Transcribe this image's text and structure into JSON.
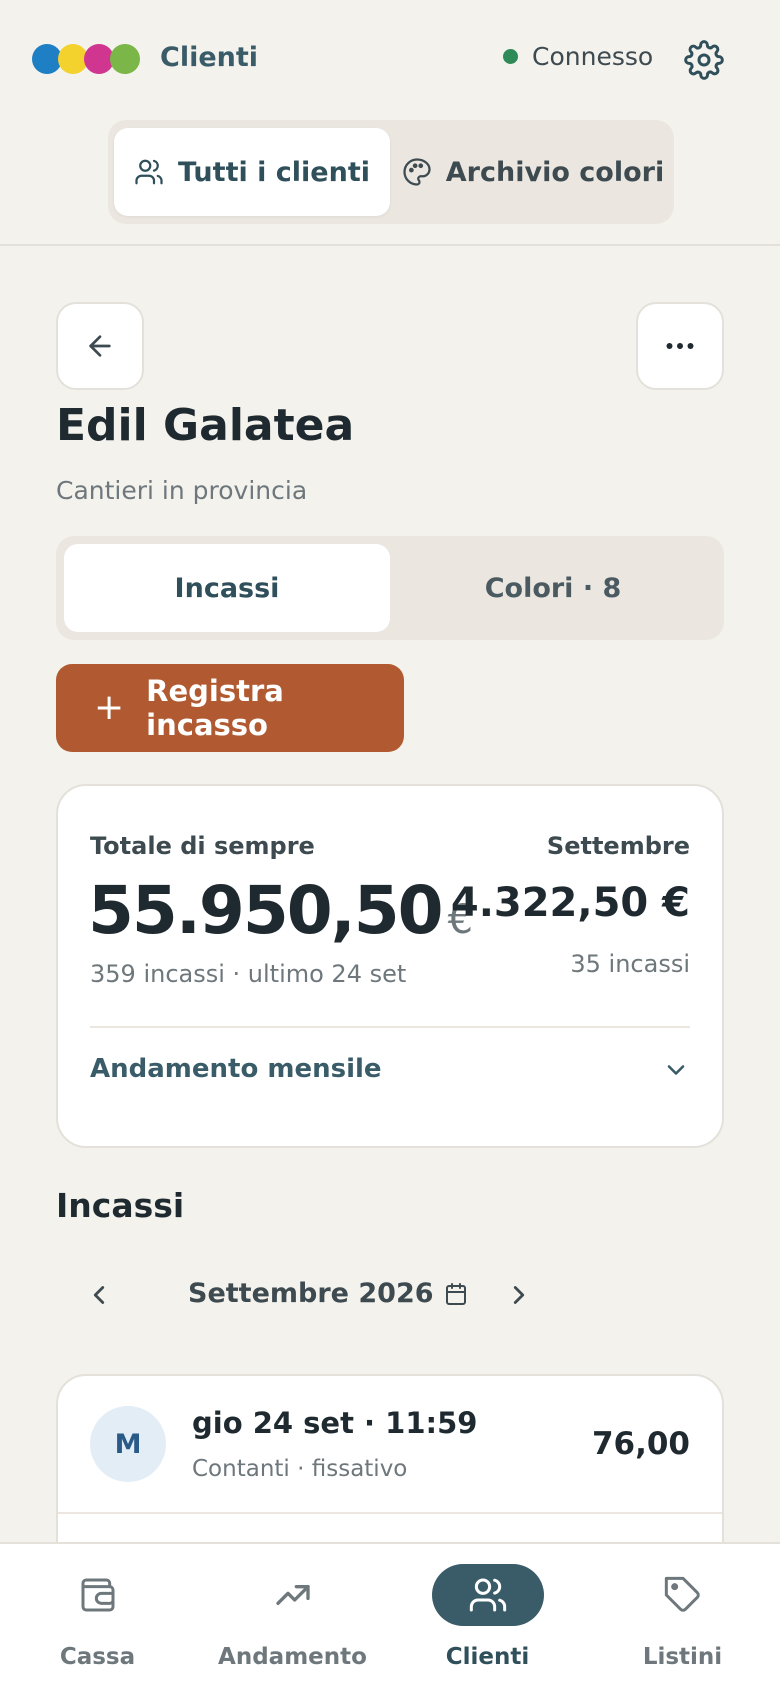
{
  "header": {
    "app_title": "Clienti",
    "logo_colors": [
      "#1e7fc4",
      "#f4d22e",
      "#d0368f",
      "#7ab648"
    ],
    "status": {
      "label": "Connesso",
      "color": "#2e8a57"
    },
    "settings_icon": "gear-icon"
  },
  "top_tabs": [
    {
      "label": "Tutti i clienti",
      "icon": "users-icon",
      "active": true
    },
    {
      "label": "Archivio colori",
      "icon": "palette-icon",
      "active": false
    }
  ],
  "client": {
    "name": "Edil Galatea",
    "subtitle": "Cantieri in provincia"
  },
  "detail_tabs": [
    {
      "label": "Incassi",
      "active": true
    },
    {
      "label": "Colori · 8",
      "active": false
    }
  ],
  "primary_action": {
    "label": "Registra incasso",
    "icon": "plus-icon",
    "color": "#b15a32"
  },
  "summary": {
    "total_label": "Totale di sempre",
    "total_value": "55.950,50",
    "currency": "€",
    "total_sub": "359 incassi · ultimo 24 set",
    "month_label": "Settembre",
    "month_value": "4.322,50 €",
    "month_sub": "35 incassi",
    "trend_label": "Andamento mensile"
  },
  "incassi": {
    "title": "Incassi",
    "month_nav_label": "Settembre 2026",
    "items": [
      {
        "avatar": "M",
        "title": "gio 24 set · 11:59",
        "subtitle": "Contanti · fissativo",
        "amount": "76,00"
      }
    ]
  },
  "bottom_nav": [
    {
      "label": "Cassa",
      "icon": "wallet-icon",
      "active": false
    },
    {
      "label": "Andamento",
      "icon": "trend-icon",
      "active": false
    },
    {
      "label": "Clienti",
      "icon": "users-icon",
      "active": true
    },
    {
      "label": "Listini",
      "icon": "tag-icon",
      "active": false
    }
  ]
}
